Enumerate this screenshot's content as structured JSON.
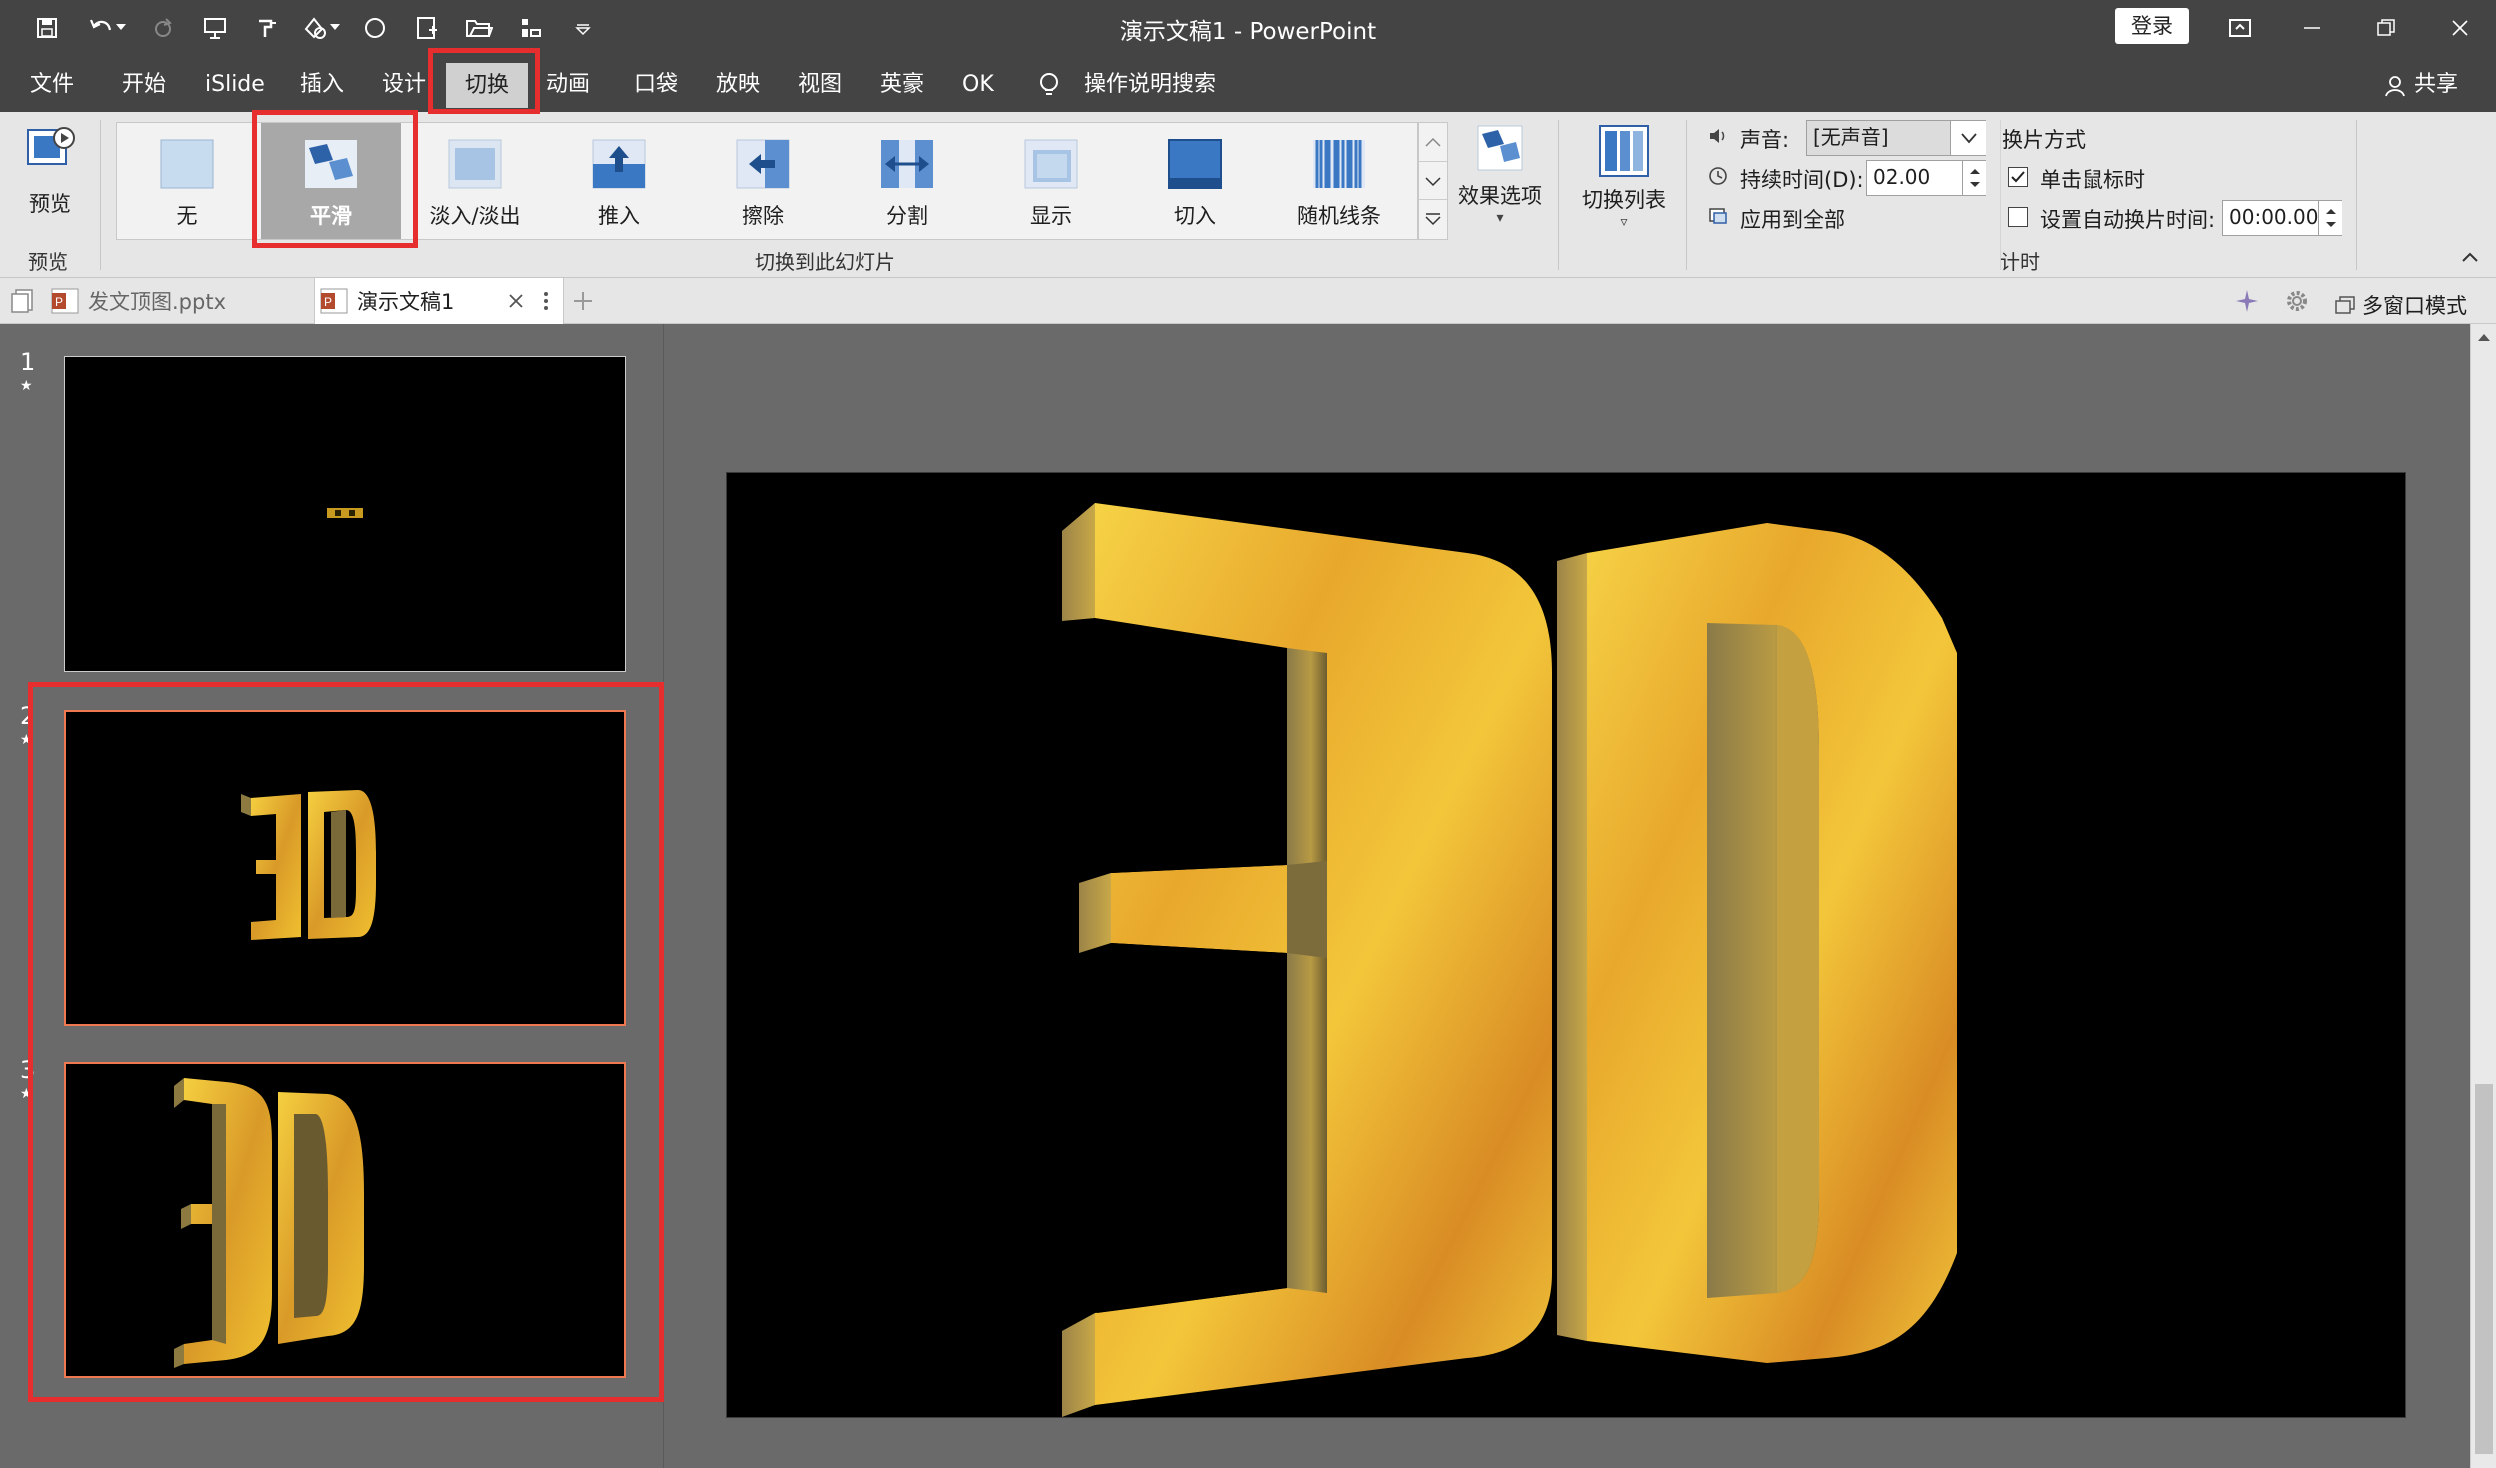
{
  "window": {
    "title": "演示文稿1 - PowerPoint",
    "login": "登录"
  },
  "menu": [
    "文件",
    "开始",
    "iSlide",
    "插入",
    "设计",
    "切换",
    "动画",
    "口袋",
    "放映",
    "视图",
    "英豪",
    "OK"
  ],
  "tell_me": "操作说明搜索",
  "share": "共享",
  "ribbon": {
    "preview": {
      "button": "预览",
      "group": "预览"
    },
    "transitions": [
      "无",
      "平滑",
      "淡入/淡出",
      "推入",
      "擦除",
      "分割",
      "显示",
      "切入",
      "随机线条"
    ],
    "selected_transition": "平滑",
    "effect_options": "效果选项",
    "transition_list": "切换列表",
    "group_label": "切换到此幻灯片",
    "timing": {
      "sound_label": "声音:",
      "sound_value": "[无声音]",
      "duration_label": "持续时间(D):",
      "duration_value": "02.00",
      "apply_all": "应用到全部",
      "advance_header": "换片方式",
      "on_click": "单击鼠标时",
      "on_click_checked": true,
      "after_label": "设置自动换片时间:",
      "after_value": "00:00.00",
      "after_checked": false,
      "group": "计时"
    }
  },
  "doc_tabs": [
    {
      "name": "发文顶图.pptx",
      "active": false
    },
    {
      "name": "演示文稿1",
      "active": true
    }
  ],
  "multiwindow": "多窗口模式",
  "slides": [
    {
      "number": "1",
      "marker": "★",
      "text": "3D"
    },
    {
      "number": "2",
      "marker": "★",
      "text": "3D"
    },
    {
      "number": "3",
      "marker": "★",
      "text": "3D"
    }
  ],
  "main_slide_text": "3D",
  "colors": {
    "title_bg": "#444444",
    "ribbon_bg": "#e6e6e6",
    "highlight": "#e62e2e",
    "selected_thumb": "#f07850",
    "gold": "#e8b820"
  }
}
